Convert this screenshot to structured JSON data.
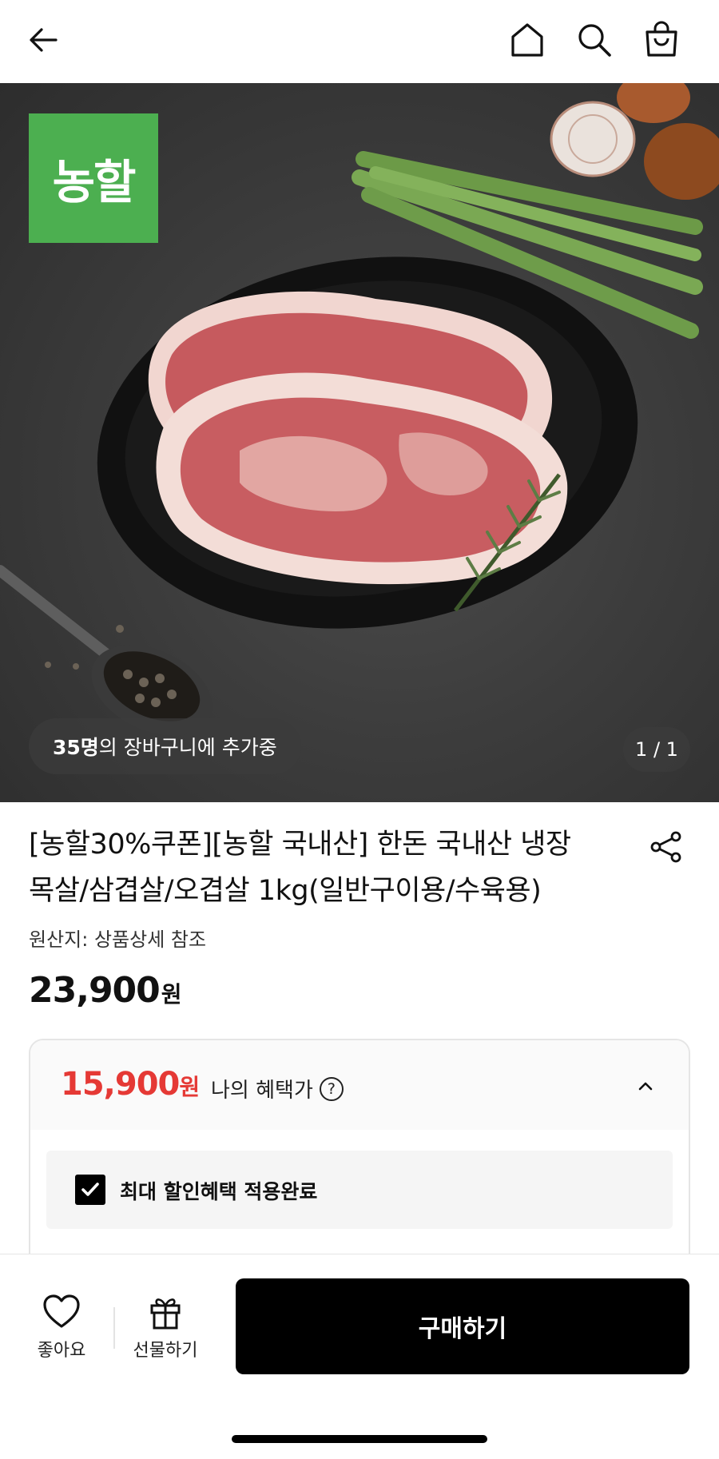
{
  "header": {
    "back_icon": "arrow-left-icon",
    "home_icon": "home-icon",
    "search_icon": "search-icon",
    "cart_icon": "shopping-bag-icon"
  },
  "hero": {
    "brand_logo_text": "농할",
    "brand_color": "#4caf50",
    "cart_count": "35명",
    "cart_text": "의 장바구니에 추가중",
    "page_indicator": "1 / 1"
  },
  "product": {
    "title_line1": "[농할30%쿠폰][농할 국내산] 한돈 국내산 냉장",
    "title_line2": "목살/삼겹살/오겹살 1kg(일반구이용/수육용)",
    "origin": "원산지: 상품상세 참조",
    "price": "23,900",
    "price_unit": "원"
  },
  "benefit": {
    "price": "15,900",
    "price_unit": "원",
    "label": "나의 혜택가",
    "help_icon": "?",
    "applied_text": "최대 할인혜택 적용완료",
    "accent_color": "#e53935"
  },
  "bottom": {
    "like_label": "좋아요",
    "gift_label": "선물하기",
    "buy_label": "구매하기"
  }
}
